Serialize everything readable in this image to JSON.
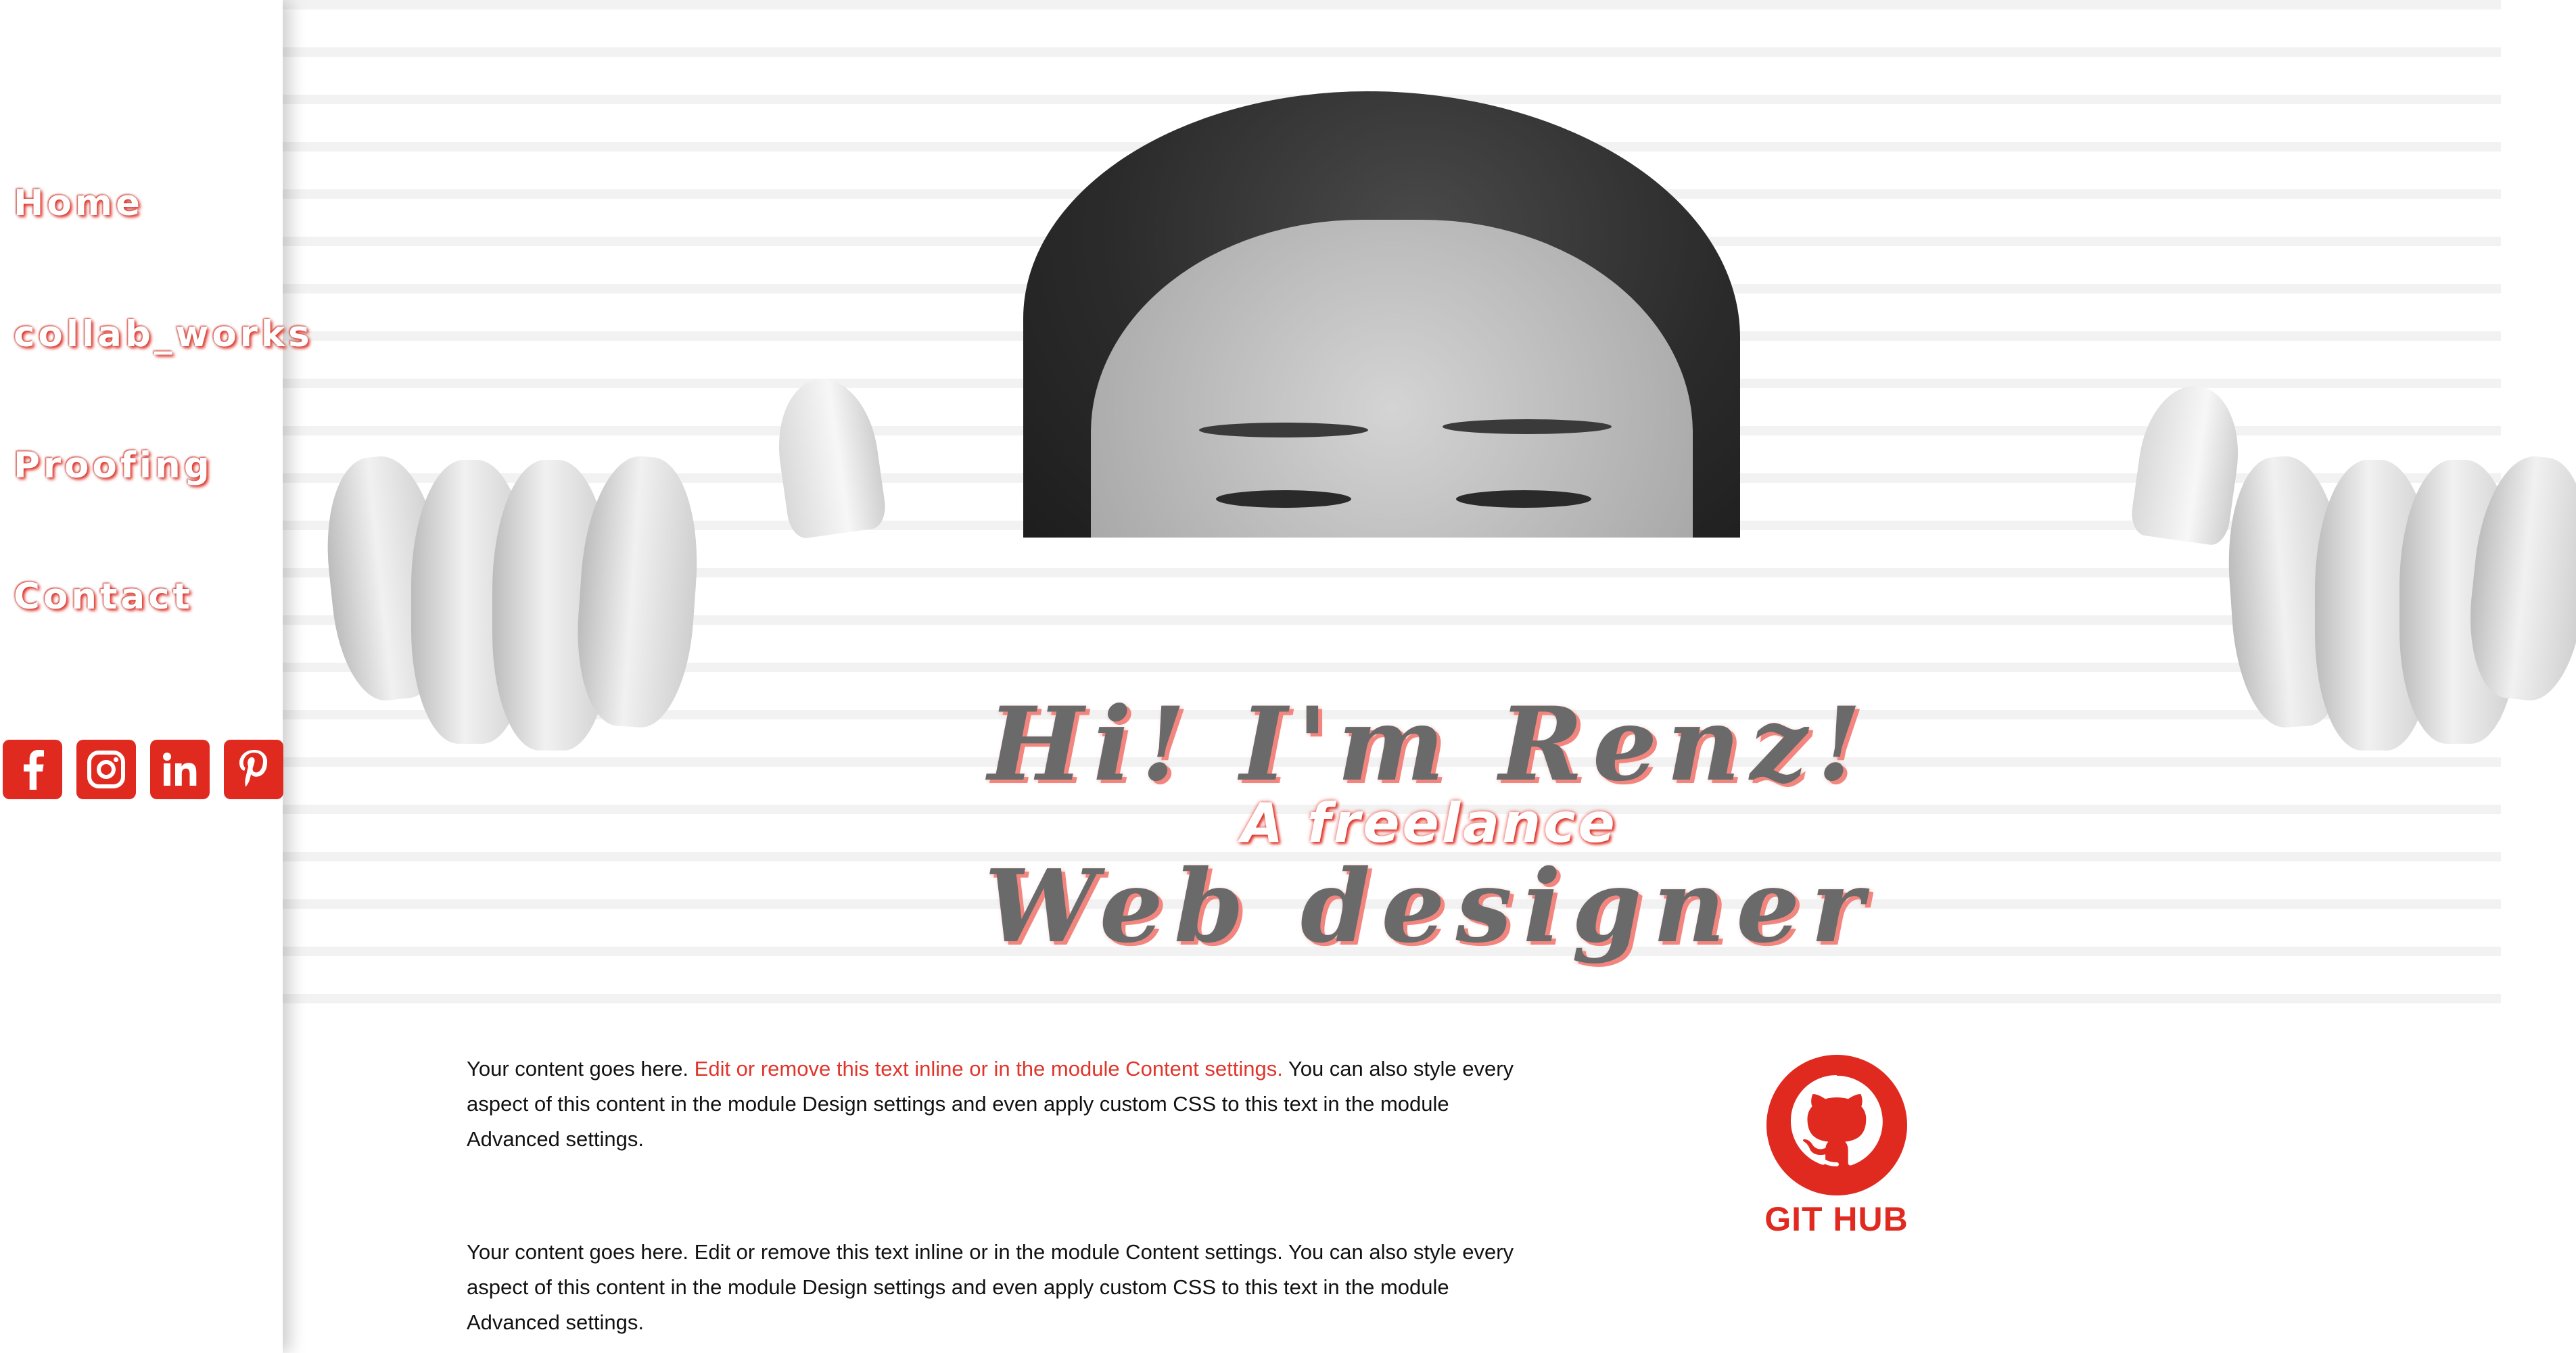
{
  "nav": {
    "items": [
      {
        "label": "Home"
      },
      {
        "label": "collab_works"
      },
      {
        "label": "Proofing"
      },
      {
        "label": "Contact"
      }
    ]
  },
  "social": {
    "items": [
      {
        "icon": "facebook-icon"
      },
      {
        "icon": "instagram-icon"
      },
      {
        "icon": "linkedin-icon"
      },
      {
        "icon": "pinterest-icon"
      }
    ],
    "color": "#e02a20"
  },
  "hero": {
    "line1": "Hi! I'm Renz!",
    "line2": "A freelance",
    "line3": "Web designer"
  },
  "content": {
    "block1": {
      "part1": "Your content goes here. ",
      "highlight": "Edit or remove this text inline or in the module Content settings.",
      "part2": " You can also style every aspect of this content in the module Design settings and even apply custom CSS to this text in the module Advanced settings."
    },
    "block2": {
      "text": "Your content goes here. Edit or remove this text inline or in the module Content settings. You can also style every aspect of this content in the module Design settings and even apply custom CSS to this text in the module Advanced settings."
    }
  },
  "github": {
    "label": "GIT HUB",
    "icon": "github-icon"
  },
  "colors": {
    "accent": "#e02a20",
    "headline_text": "#6a6a6a",
    "headline_shadow": "#f2857e"
  }
}
